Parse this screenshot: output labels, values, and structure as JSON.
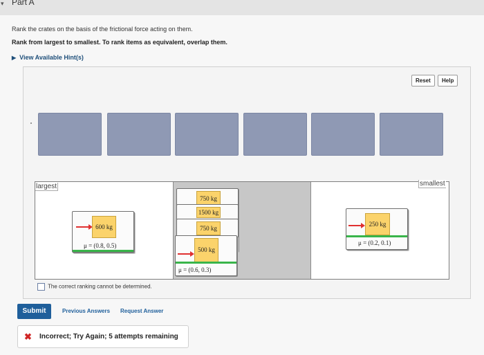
{
  "part": {
    "label": "Part A"
  },
  "question": {
    "line1": "Rank the crates on the basis of the frictional force acting on them.",
    "line2": "Rank from largest to smallest. To rank items as equivalent, overlap them.",
    "hint_link": "View Available Hint(s)"
  },
  "toolbar": {
    "reset": "Reset",
    "help": "Help"
  },
  "zones": {
    "largest": "largest",
    "smallest": "smallest"
  },
  "cards": [
    {
      "mass": "600 kg",
      "mu": "μ = (0.8, 0.5)"
    },
    {
      "mass": "750 kg"
    },
    {
      "mass": "1500 kg"
    },
    {
      "mass": "750 kg"
    },
    {
      "mass": "500 kg",
      "mu": "μ = (0.6, 0.3)"
    },
    {
      "mass": "250 kg",
      "mu": "μ = (0.2, 0.1)"
    }
  ],
  "checkbox_label": "The correct ranking cannot be determined.",
  "actions": {
    "submit": "Submit",
    "previous": "Previous Answers",
    "request": "Request Answer"
  },
  "feedback": {
    "text": "Incorrect; Try Again; 5 attempts remaining"
  },
  "colors": {
    "slot": "#8f99b4",
    "crate": "#fbd36b",
    "submit": "#1f5f9b",
    "arrow": "#e03030",
    "ground": "#39b54a"
  }
}
